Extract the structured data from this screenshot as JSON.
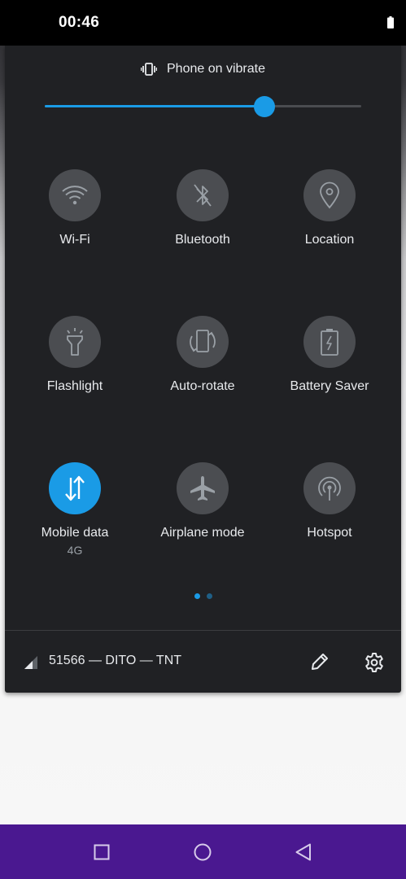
{
  "status_bar": {
    "time": "00:46"
  },
  "quick_settings": {
    "ringer_label": "Phone on vibrate",
    "ringer_level_fraction": 0.695,
    "tiles": [
      {
        "id": "wifi",
        "label": "Wi-Fi",
        "sublabel": "",
        "icon": "wifi-icon",
        "active": false
      },
      {
        "id": "bluetooth",
        "label": "Bluetooth",
        "sublabel": "",
        "icon": "bluetooth-icon",
        "active": false
      },
      {
        "id": "location",
        "label": "Location",
        "sublabel": "",
        "icon": "location-icon",
        "active": false
      },
      {
        "id": "flashlight",
        "label": "Flashlight",
        "sublabel": "",
        "icon": "flashlight-icon",
        "active": false
      },
      {
        "id": "auto-rotate",
        "label": "Auto-rotate",
        "sublabel": "",
        "icon": "auto-rotate-icon",
        "active": false
      },
      {
        "id": "battery-saver",
        "label": "Battery Saver",
        "sublabel": "",
        "icon": "battery-saver-icon",
        "active": false
      },
      {
        "id": "mobile-data",
        "label": "Mobile data",
        "sublabel": "4G",
        "icon": "mobile-data-icon",
        "active": true
      },
      {
        "id": "airplane-mode",
        "label": "Airplane mode",
        "sublabel": "",
        "icon": "airplane-icon",
        "active": false
      },
      {
        "id": "hotspot",
        "label": "Hotspot",
        "sublabel": "",
        "icon": "hotspot-icon",
        "active": false
      }
    ],
    "page_indicator": {
      "pages": 2,
      "current": 1
    },
    "footer": {
      "carrier_text": "51566 — DITO — TNT"
    }
  },
  "colors": {
    "accent": "#1a9be6",
    "panel_bg": "#202124",
    "tile_inactive": "#4b4d51",
    "nav_bar": "#4a1890"
  },
  "nav_bar": {
    "buttons": [
      "recents-icon",
      "home-icon",
      "back-icon"
    ]
  }
}
